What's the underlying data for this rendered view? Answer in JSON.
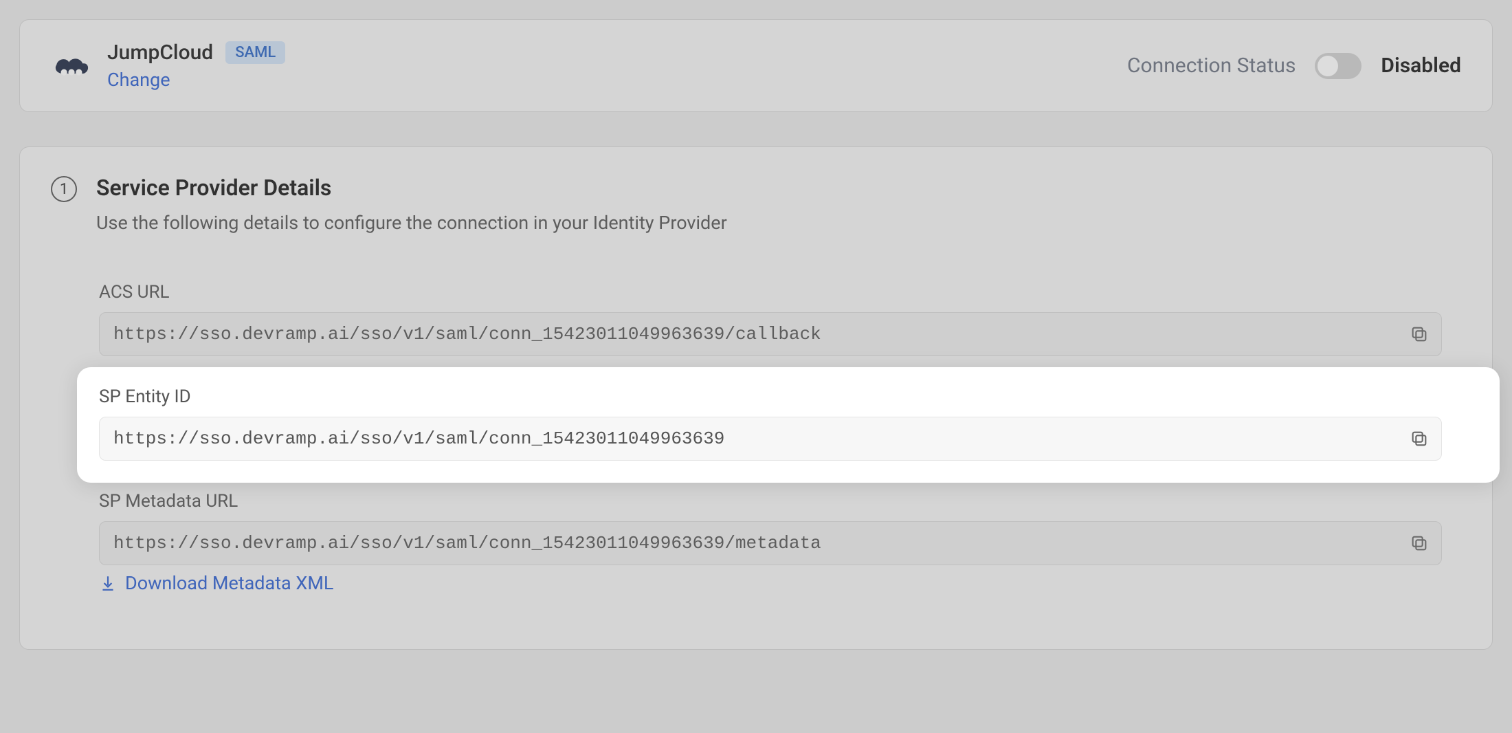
{
  "header": {
    "provider_name": "JumpCloud",
    "badge": "SAML",
    "change_label": "Change",
    "status_label": "Connection Status",
    "status_value": "Disabled",
    "toggle_on": false
  },
  "section": {
    "step": "1",
    "title": "Service Provider Details",
    "subtitle": "Use the following details to configure the connection in your Identity Provider"
  },
  "fields": {
    "acs": {
      "label": "ACS URL",
      "value": "https://sso.devramp.ai/sso/v1/saml/conn_15423011049963639/callback"
    },
    "entity": {
      "label": "SP Entity ID",
      "value": "https://sso.devramp.ai/sso/v1/saml/conn_15423011049963639"
    },
    "metadata": {
      "label": "SP Metadata URL",
      "value": "https://sso.devramp.ai/sso/v1/saml/conn_15423011049963639/metadata"
    }
  },
  "download_label": "Download Metadata XML"
}
